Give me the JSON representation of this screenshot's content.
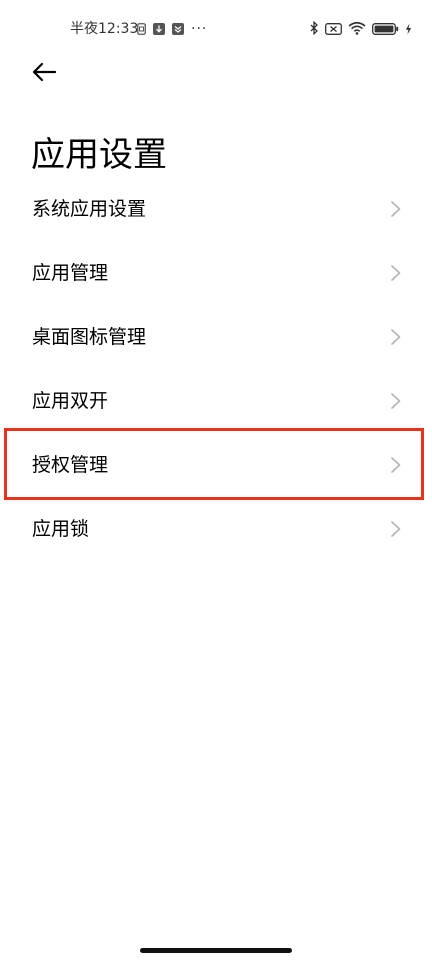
{
  "status_bar": {
    "time": "半夜12:33",
    "icons_left": [
      "sim-card-icon",
      "download-icon",
      "notification-icon",
      "more-dots-icon"
    ],
    "icons_right": [
      "bluetooth-icon",
      "no-signal-icon",
      "wifi-icon",
      "battery-icon",
      "charging-icon"
    ],
    "more_dots": "···"
  },
  "header": {
    "back_icon": "back-arrow-icon",
    "title": "应用设置"
  },
  "menu": {
    "items": [
      {
        "label": "系统应用设置"
      },
      {
        "label": "应用管理"
      },
      {
        "label": "桌面图标管理"
      },
      {
        "label": "应用双开"
      },
      {
        "label": "授权管理"
      },
      {
        "label": "应用锁"
      }
    ],
    "chevron_icon": "chevron-right-icon"
  },
  "highlight": {
    "item_label": "授权管理",
    "color": "#e8341c"
  }
}
